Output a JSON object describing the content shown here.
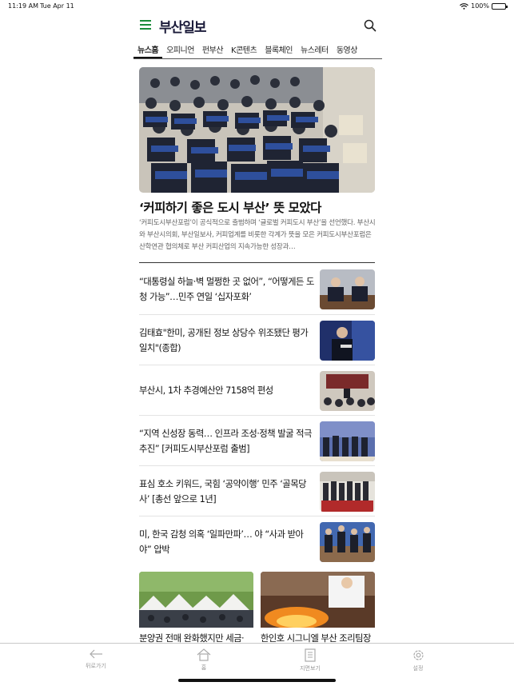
{
  "status": {
    "time": "11:19 AM",
    "date": "Tue Apr 11",
    "battery": "100%",
    "battery_level": 1.0
  },
  "header": {
    "logo": "부산일보",
    "menu_icon": "hamburger-menu-icon",
    "search_icon": "search-icon",
    "accent_color": "#1a8c3a"
  },
  "tabs": [
    {
      "label": "뉴스홈",
      "active": true
    },
    {
      "label": "오피니언"
    },
    {
      "label": "펀부산"
    },
    {
      "label": "K콘텐츠"
    },
    {
      "label": "블록체인"
    },
    {
      "label": "뉴스레터"
    },
    {
      "label": "동영상"
    }
  ],
  "hero": {
    "title": "‘커피하기 좋은 도시 부산’ 뜻 모았다",
    "summary": "‘커피도시부산포럼’이 공식적으로 출범하며 ‘글로벌 커피도시 부산’을 선언했다. 부산시와 부산시의회, 부산일보사, 커피업계를 비롯한 각계가 뜻을 모은 커피도시부산포럼은 산학연관 협의체로 부산 커피산업의 지속가능한 성장과…"
  },
  "articles": [
    {
      "title": "“대통령실 하늘·벽 멀쩡한 곳 없어”, “어떻게든 도청 가능”…민주 연일 ‘십자포화’"
    },
    {
      "title": "김태효\"한미, 공개된 정보 상당수 위조됐단 평가 일치\"(종합)"
    },
    {
      "title": "부산시, 1차 추경예산안 7158억 편성"
    },
    {
      "title": "“지역 신성장 동력… 인프라 조성·정책 발굴 적극 추진” [커피도시부산포럼 출범]"
    },
    {
      "title": "표심 호소 키워드, 국힘 ‘공약이행’ 민주 ‘골목당사’ [총선 앞으로 1년]"
    },
    {
      "title": "미, 한국 감청 의혹 ‘일파만파’… 야 “사과 받아야” 압박"
    }
  ],
  "cards": [
    {
      "title": "분양권 전매 완화했지만 세금·"
    },
    {
      "title": "한인호 시그니엘 부산 조리팀장"
    }
  ],
  "tabbar": [
    {
      "label": "뒤로가기",
      "icon": "back-arrow-icon"
    },
    {
      "label": "홈",
      "icon": "home-icon"
    },
    {
      "label": "지면보기",
      "icon": "newspaper-icon"
    },
    {
      "label": "설정",
      "icon": "gear-icon"
    }
  ]
}
